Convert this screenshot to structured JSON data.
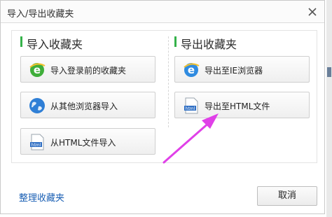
{
  "dialog": {
    "title": "导入/导出收藏夹",
    "close_icon": "close-icon"
  },
  "import_section": {
    "title": "导入收藏夹",
    "buttons": [
      {
        "label": "导入登录前的收藏夹",
        "icon": "ie-green-icon"
      },
      {
        "label": "从其他浏览器导入",
        "icon": "globe-icon"
      },
      {
        "label": "从HTML文件导入",
        "icon": "html-file-icon"
      }
    ]
  },
  "export_section": {
    "title": "导出收藏夹",
    "buttons": [
      {
        "label": "导出至IE浏览器",
        "icon": "ie-blue-icon"
      },
      {
        "label": "导出至HTML文件",
        "icon": "html-file-icon"
      }
    ]
  },
  "footer": {
    "manage_link": "整理收藏夹",
    "cancel_label": "取消"
  },
  "colors": {
    "accent_green": "#35b24a",
    "link_blue": "#1a5fb4",
    "annotation_arrow": "#e040e8"
  }
}
